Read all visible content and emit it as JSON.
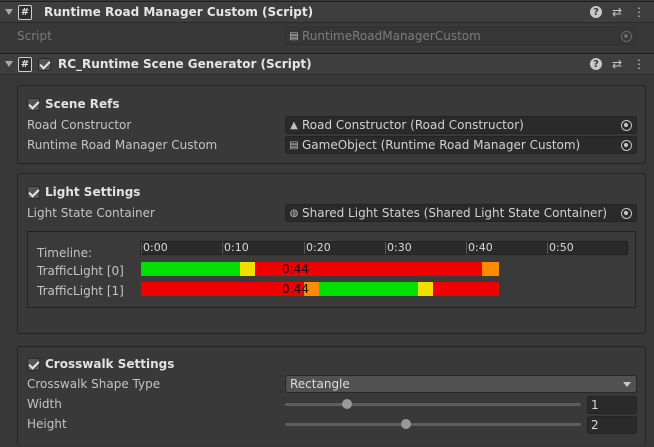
{
  "component1": {
    "title": "Runtime Road Manager Custom (Script)",
    "script_label": "Script",
    "script_value": "RuntimeRoadManagerCustom"
  },
  "component2": {
    "title": "RC_Runtime Scene Generator (Script)",
    "enabled": true
  },
  "scene_refs": {
    "title": "Scene Refs",
    "enabled": true,
    "road_constructor_label": "Road Constructor",
    "road_constructor_value": "Road Constructor (Road Constructor)",
    "runtime_manager_label": "Runtime Road Manager Custom",
    "runtime_manager_value": "GameObject (Runtime Road Manager Custom)"
  },
  "light_settings": {
    "title": "Light Settings",
    "enabled": true,
    "container_label": "Light State Container",
    "container_value": "Shared Light States (Shared Light State Container)",
    "timeline_label": "Timeline:",
    "ticks": [
      "0:00",
      "0:10",
      "0:20",
      "0:30",
      "0:40",
      "0:50"
    ],
    "tracks": [
      {
        "label": "TrafficLight [0]",
        "time_label": "0:44",
        "segments": [
          {
            "color": "#00e000",
            "start": 0,
            "end": 0.277
          },
          {
            "color": "#f0e000",
            "start": 0.277,
            "end": 0.318
          },
          {
            "color": "#f00000",
            "start": 0.318,
            "end": 0.953
          },
          {
            "color": "#ff8c00",
            "start": 0.953,
            "end": 1.0
          }
        ]
      },
      {
        "label": "TrafficLight [1]",
        "time_label": "0:44",
        "segments": [
          {
            "color": "#f00000",
            "start": 0,
            "end": 0.455
          },
          {
            "color": "#ff8c00",
            "start": 0.455,
            "end": 0.497
          },
          {
            "color": "#00e000",
            "start": 0.497,
            "end": 0.773
          },
          {
            "color": "#f0e000",
            "start": 0.773,
            "end": 0.816
          },
          {
            "color": "#f00000",
            "start": 0.816,
            "end": 1.0
          }
        ]
      }
    ]
  },
  "crosswalk": {
    "title": "Crosswalk Settings",
    "enabled": true,
    "shape_label": "Crosswalk Shape Type",
    "shape_value": "Rectangle",
    "width_label": "Width",
    "width_value": "1",
    "width_fraction": 0.21,
    "height_label": "Height",
    "height_value": "2",
    "height_fraction": 0.41
  }
}
